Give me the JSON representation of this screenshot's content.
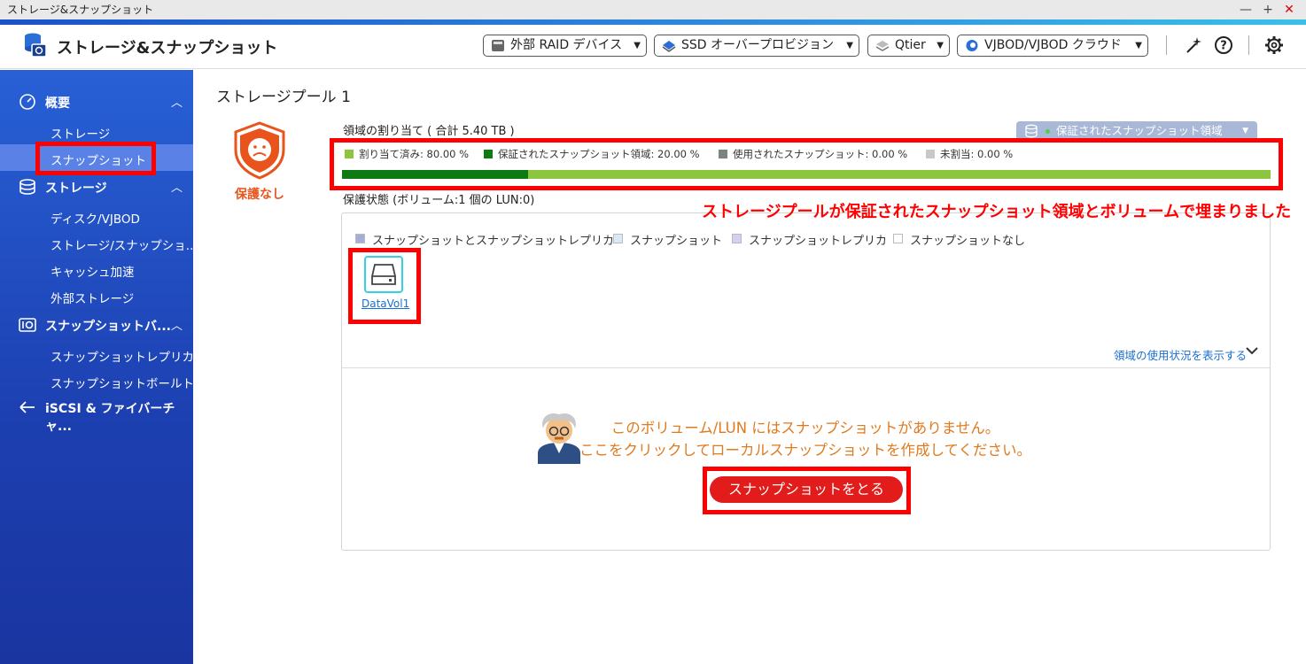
{
  "window": {
    "title": "ストレージ&スナップショット",
    "controls": [
      "—",
      "+",
      "✕"
    ]
  },
  "header": {
    "app_title": "ストレージ&スナップショット",
    "dropdowns": [
      {
        "label": "外部 RAID デバイス",
        "icon": "raid-device-icon"
      },
      {
        "label": "SSD オーバープロビジョン",
        "icon": "ssd-icon"
      },
      {
        "label": "Qtier",
        "icon": "qtier-icon"
      },
      {
        "label": "VJBOD/VJBOD クラウド",
        "icon": "vjbod-cloud-icon"
      }
    ],
    "icons": [
      "magic-wand-icon",
      "help-icon",
      "gear-icon"
    ]
  },
  "sidebar": {
    "sections": [
      {
        "label": "概要",
        "icon": "dashboard-icon",
        "expanded": true,
        "items": [
          {
            "label": "ストレージ"
          },
          {
            "label": "スナップショット",
            "active": true
          }
        ]
      },
      {
        "label": "ストレージ",
        "icon": "database-icon",
        "expanded": true,
        "items": [
          {
            "label": "ディスク/VJBOD"
          },
          {
            "label": "ストレージ/スナップショ..."
          },
          {
            "label": "キャッシュ加速"
          },
          {
            "label": "外部ストレージ"
          }
        ]
      },
      {
        "label": "スナップショットバ...",
        "icon": "snapshot-backup-icon",
        "expanded": true,
        "items": [
          {
            "label": "スナップショットレプリカ"
          },
          {
            "label": "スナップショットボールト"
          }
        ]
      },
      {
        "label": "iSCSI & ファイバーチャ...",
        "icon": "iscsi-icon",
        "expanded": false,
        "items": []
      }
    ]
  },
  "main": {
    "pool_title": "ストレージプール 1",
    "protection_status": "保護なし",
    "allocation": {
      "title": "領域の割り当て ( 合計 5.40 TB )",
      "snapshot_area_button": "保証されたスナップショット領域",
      "legend": [
        {
          "label": "割り当て済み: 80.00 %",
          "color": "#8cc63f",
          "percent": 80.0
        },
        {
          "label": "保証されたスナップショット領域: 20.00 %",
          "color": "#0e7a14",
          "percent": 20.0
        },
        {
          "label": "使用されたスナップショット: 0.00 %",
          "color": "#7b8580",
          "percent": 0.0
        },
        {
          "label": "未割当: 0.00 %",
          "color": "#c8c8c8",
          "percent": 0.0
        }
      ]
    },
    "protection_state_label": "保護状態 (ボリューム:1 個の LUN:0)",
    "legend2": [
      {
        "label": "スナップショットとスナップショットレプリカ",
        "color": "#a5add8"
      },
      {
        "label": "スナップショット",
        "color": "#d8eaf8"
      },
      {
        "label": "スナップショットレプリカ",
        "color": "#d4d0f2"
      },
      {
        "label": "スナップショットなし",
        "color": "#ffffff"
      }
    ],
    "volume": {
      "name": "DataVol1"
    },
    "usage_link": "領域の使用状況を表示する",
    "empty_message_1": "このボリューム/LUN にはスナップショットがありません。",
    "empty_message_2": "ここをクリックしてローカルスナップショットを作成してください。",
    "take_snapshot_button": "スナップショットをとる"
  },
  "annotation": {
    "text": "ストレージプールが保証されたスナップショット領域とボリュームで埋まりました",
    "color": "#ff0000"
  }
}
